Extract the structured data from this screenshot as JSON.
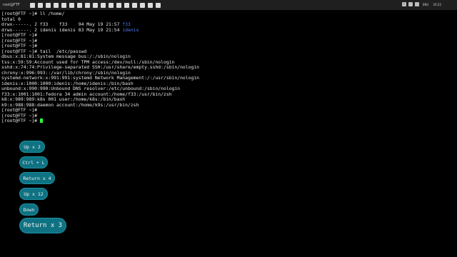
{
  "window": {
    "title": "root@FTF:~"
  },
  "toolbar": {
    "icons": [
      "app-icon",
      "explorer-icon",
      "edge-icon",
      "store-icon",
      "mail-icon",
      "photos-icon",
      "terminal-icon",
      "settings-icon",
      "chrome-icon",
      "vscode-icon",
      "files-icon",
      "paint-icon",
      "calc-icon",
      "media-icon",
      "notes-icon",
      "camera-icon",
      "music-icon"
    ]
  },
  "tray": {
    "lang": "ENG",
    "time": "20:22"
  },
  "terminal": {
    "lines": [
      "[root@FTF ~]# ll /home/",
      "total 0",
      [
        "drwx------. 2 f33    f33    94 May 19 21:57 ",
        "f33"
      ],
      [
        "drwx------. 2 idenis idenis 83 May 19 21:54 ",
        "idenis"
      ],
      "[root@FTF ~]#",
      "[root@FTF ~]#",
      "[root@FTF ~]#",
      "[root@FTF ~]# tail  /etc/passwd",
      "dbus:x:81:81:System message bus:/:/sbin/nologin",
      "tss:x:59:59:Account used for TPM access:/dev/null:/sbin/nologin",
      "sshd:x:74:74:Privilege-separated SSH:/usr/share/empty.sshd:/sbin/nologin",
      "chrony:x:996:993::/var/lib/chrony:/sbin/nologin",
      "systemd-network:x:991:991:systemd Network Management:/:/usr/sbin/nologin",
      "idenis:x:1000:1000:idenis:/home/idenis:/bin/bash",
      "unbound:x:990:990:Unbound DNS resolver:/etc/unbound:/sbin/nologin",
      "f33:x:1001:1001:fedora 34 admin account:/home/f33:/usr/bin/zsh",
      "k8:x:989:989:k8s 001 user:/home/k8s:/bin/bash",
      "k9:x:988:988:daemon account:/home/k9s:/usr/bin/zsh",
      "[root@FTF ~]#",
      "[root@FTF ~]#",
      "[root@FTF ~]# "
    ]
  },
  "keys": [
    "Up x 2",
    "Ctrl + L",
    "Return x 4",
    "Up x 12",
    "Down",
    "Return x 3"
  ]
}
